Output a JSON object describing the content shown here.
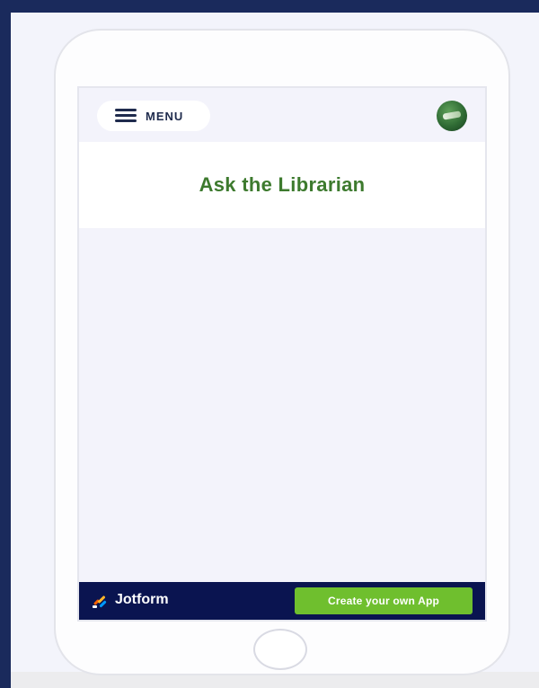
{
  "app_header": {
    "menu_label": "MENU",
    "avatar_icon": "avatar-logo-icon"
  },
  "page": {
    "title": "Ask the Librarian"
  },
  "footer": {
    "brand_name": "Jotform",
    "brand_icon": "jotform-logo-icon",
    "cta_label": "Create your own App"
  },
  "colors": {
    "title_green": "#3d7a2e",
    "footer_navy": "#0a1450",
    "cta_green": "#6fbf2e"
  }
}
